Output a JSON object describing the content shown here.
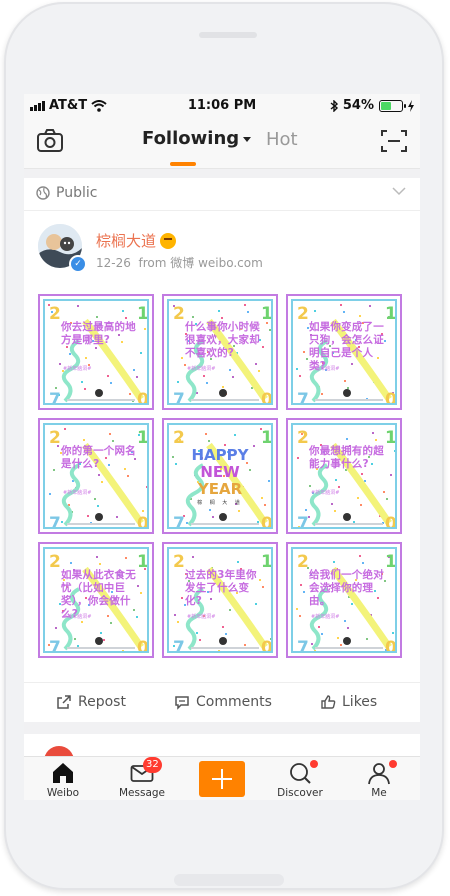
{
  "status": {
    "carrier": "AT&T",
    "time": "11:06 PM",
    "battery": "54%",
    "battery_level": 0.54
  },
  "nav": {
    "following_label": "Following",
    "hot_label": "Hot",
    "camera_icon": "camera-icon",
    "scan_icon": "scan-icon"
  },
  "post": {
    "visibility": "Public",
    "username": "棕榈大道",
    "date": "12-26",
    "source": "from 微博 weibo.com",
    "tiles": [
      {
        "text": "你去过最高的地方是哪里?",
        "tag": "#新年脑洞#"
      },
      {
        "text": "什么事你小时候很喜欢，大家却不喜欢的?",
        "tag": "#新年脑洞#"
      },
      {
        "text": "如果你变成了一只狗，会怎么证明自己是个人类?",
        "tag": "#新年脑洞#"
      },
      {
        "text": "你的第一个网名是什么?",
        "tag": "#新年脑洞#"
      },
      {
        "text": "HAPPY NEW YEAR",
        "tag": "棕 榈 大 道"
      },
      {
        "text": "你最想拥有的超能力事什么?",
        "tag": "#新年脑洞#"
      },
      {
        "text": "如果从此衣食无忧（比如中巨奖），你会做什么?",
        "tag": "#新年脑洞#"
      },
      {
        "text": "过去的3年里你发生了什么变化?",
        "tag": "#新年脑洞#"
      },
      {
        "text": "给我们一个绝对会选择你的理由。",
        "tag": "#新年脑洞#"
      }
    ],
    "happy": [
      "HAPPY",
      "NEW",
      "YEAR"
    ],
    "happy_brand": "棕 榈 大 道"
  },
  "actions": {
    "repost": "Repost",
    "comments": "Comments",
    "likes": "Likes"
  },
  "tabbar": {
    "weibo": "Weibo",
    "message": "Message",
    "message_badge": "32",
    "discover": "Discover",
    "me": "Me"
  },
  "colors": {
    "accent": "#ff8200",
    "username": "#eb7350",
    "badge": "#ff3b30"
  }
}
